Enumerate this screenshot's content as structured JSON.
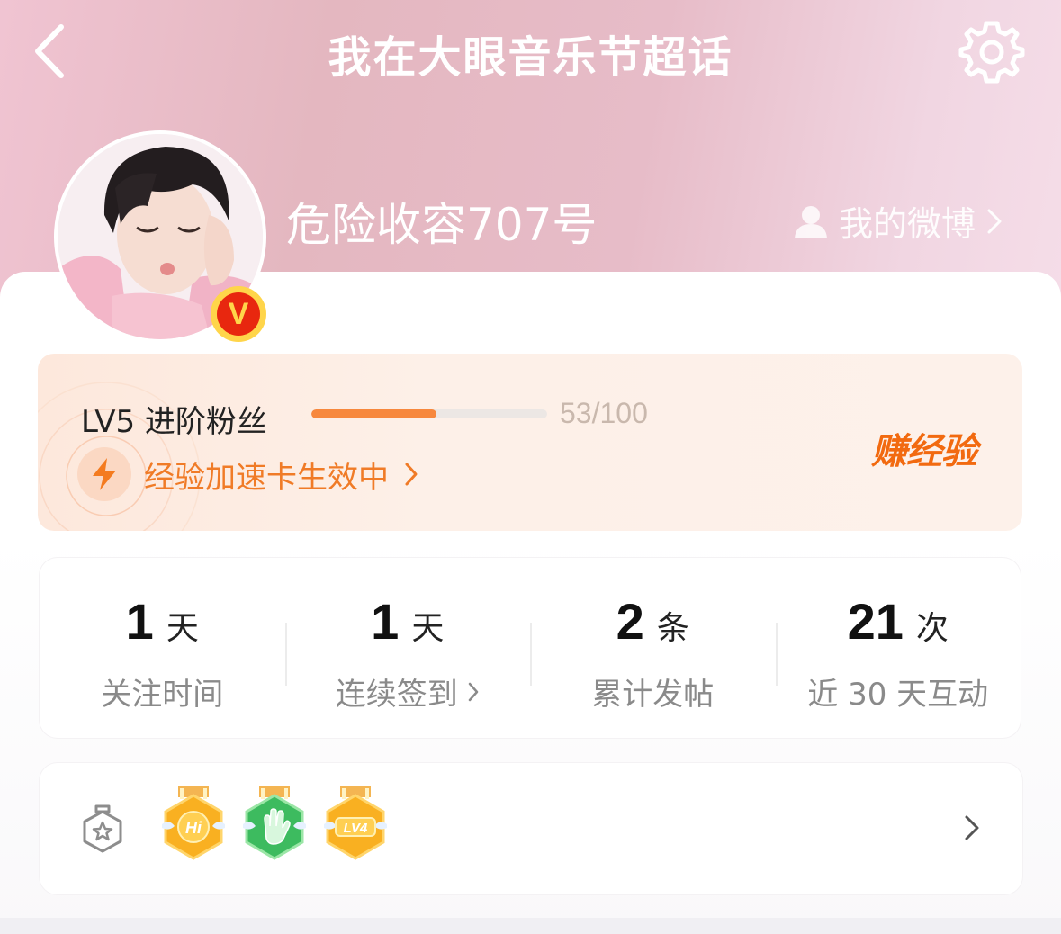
{
  "header": {
    "title": "我在大眼音乐节超话",
    "back_icon": "back-arrow-icon",
    "settings_icon": "gear-icon"
  },
  "profile": {
    "username": "危险收容707号",
    "my_weibo_label": "我的微博",
    "verified_badge": "V"
  },
  "level": {
    "label": "LV5 进阶粉丝",
    "progress_text": "53/100",
    "progress_fraction": 0.53,
    "boost_label": "经验加速卡生效中",
    "earn_label": "赚经验",
    "accent": "#f7883d"
  },
  "stats": [
    {
      "value": "1",
      "unit": "天",
      "label": "关注时间",
      "has_arrow": false
    },
    {
      "value": "1",
      "unit": "天",
      "label": "连续签到",
      "has_arrow": true
    },
    {
      "value": "2",
      "unit": "条",
      "label": "累计发帖",
      "has_arrow": false
    },
    {
      "value": "21",
      "unit": "次",
      "label": "近 30 天互动",
      "has_arrow": false
    }
  ],
  "medals": {
    "items": [
      {
        "name": "hi-medal",
        "text": "Hi",
        "color": "#f9b021"
      },
      {
        "name": "hand-medal",
        "text": "",
        "color": "#3dbb5f"
      },
      {
        "name": "lv4-medal",
        "text": "LV4",
        "color": "#f9b021"
      }
    ]
  }
}
